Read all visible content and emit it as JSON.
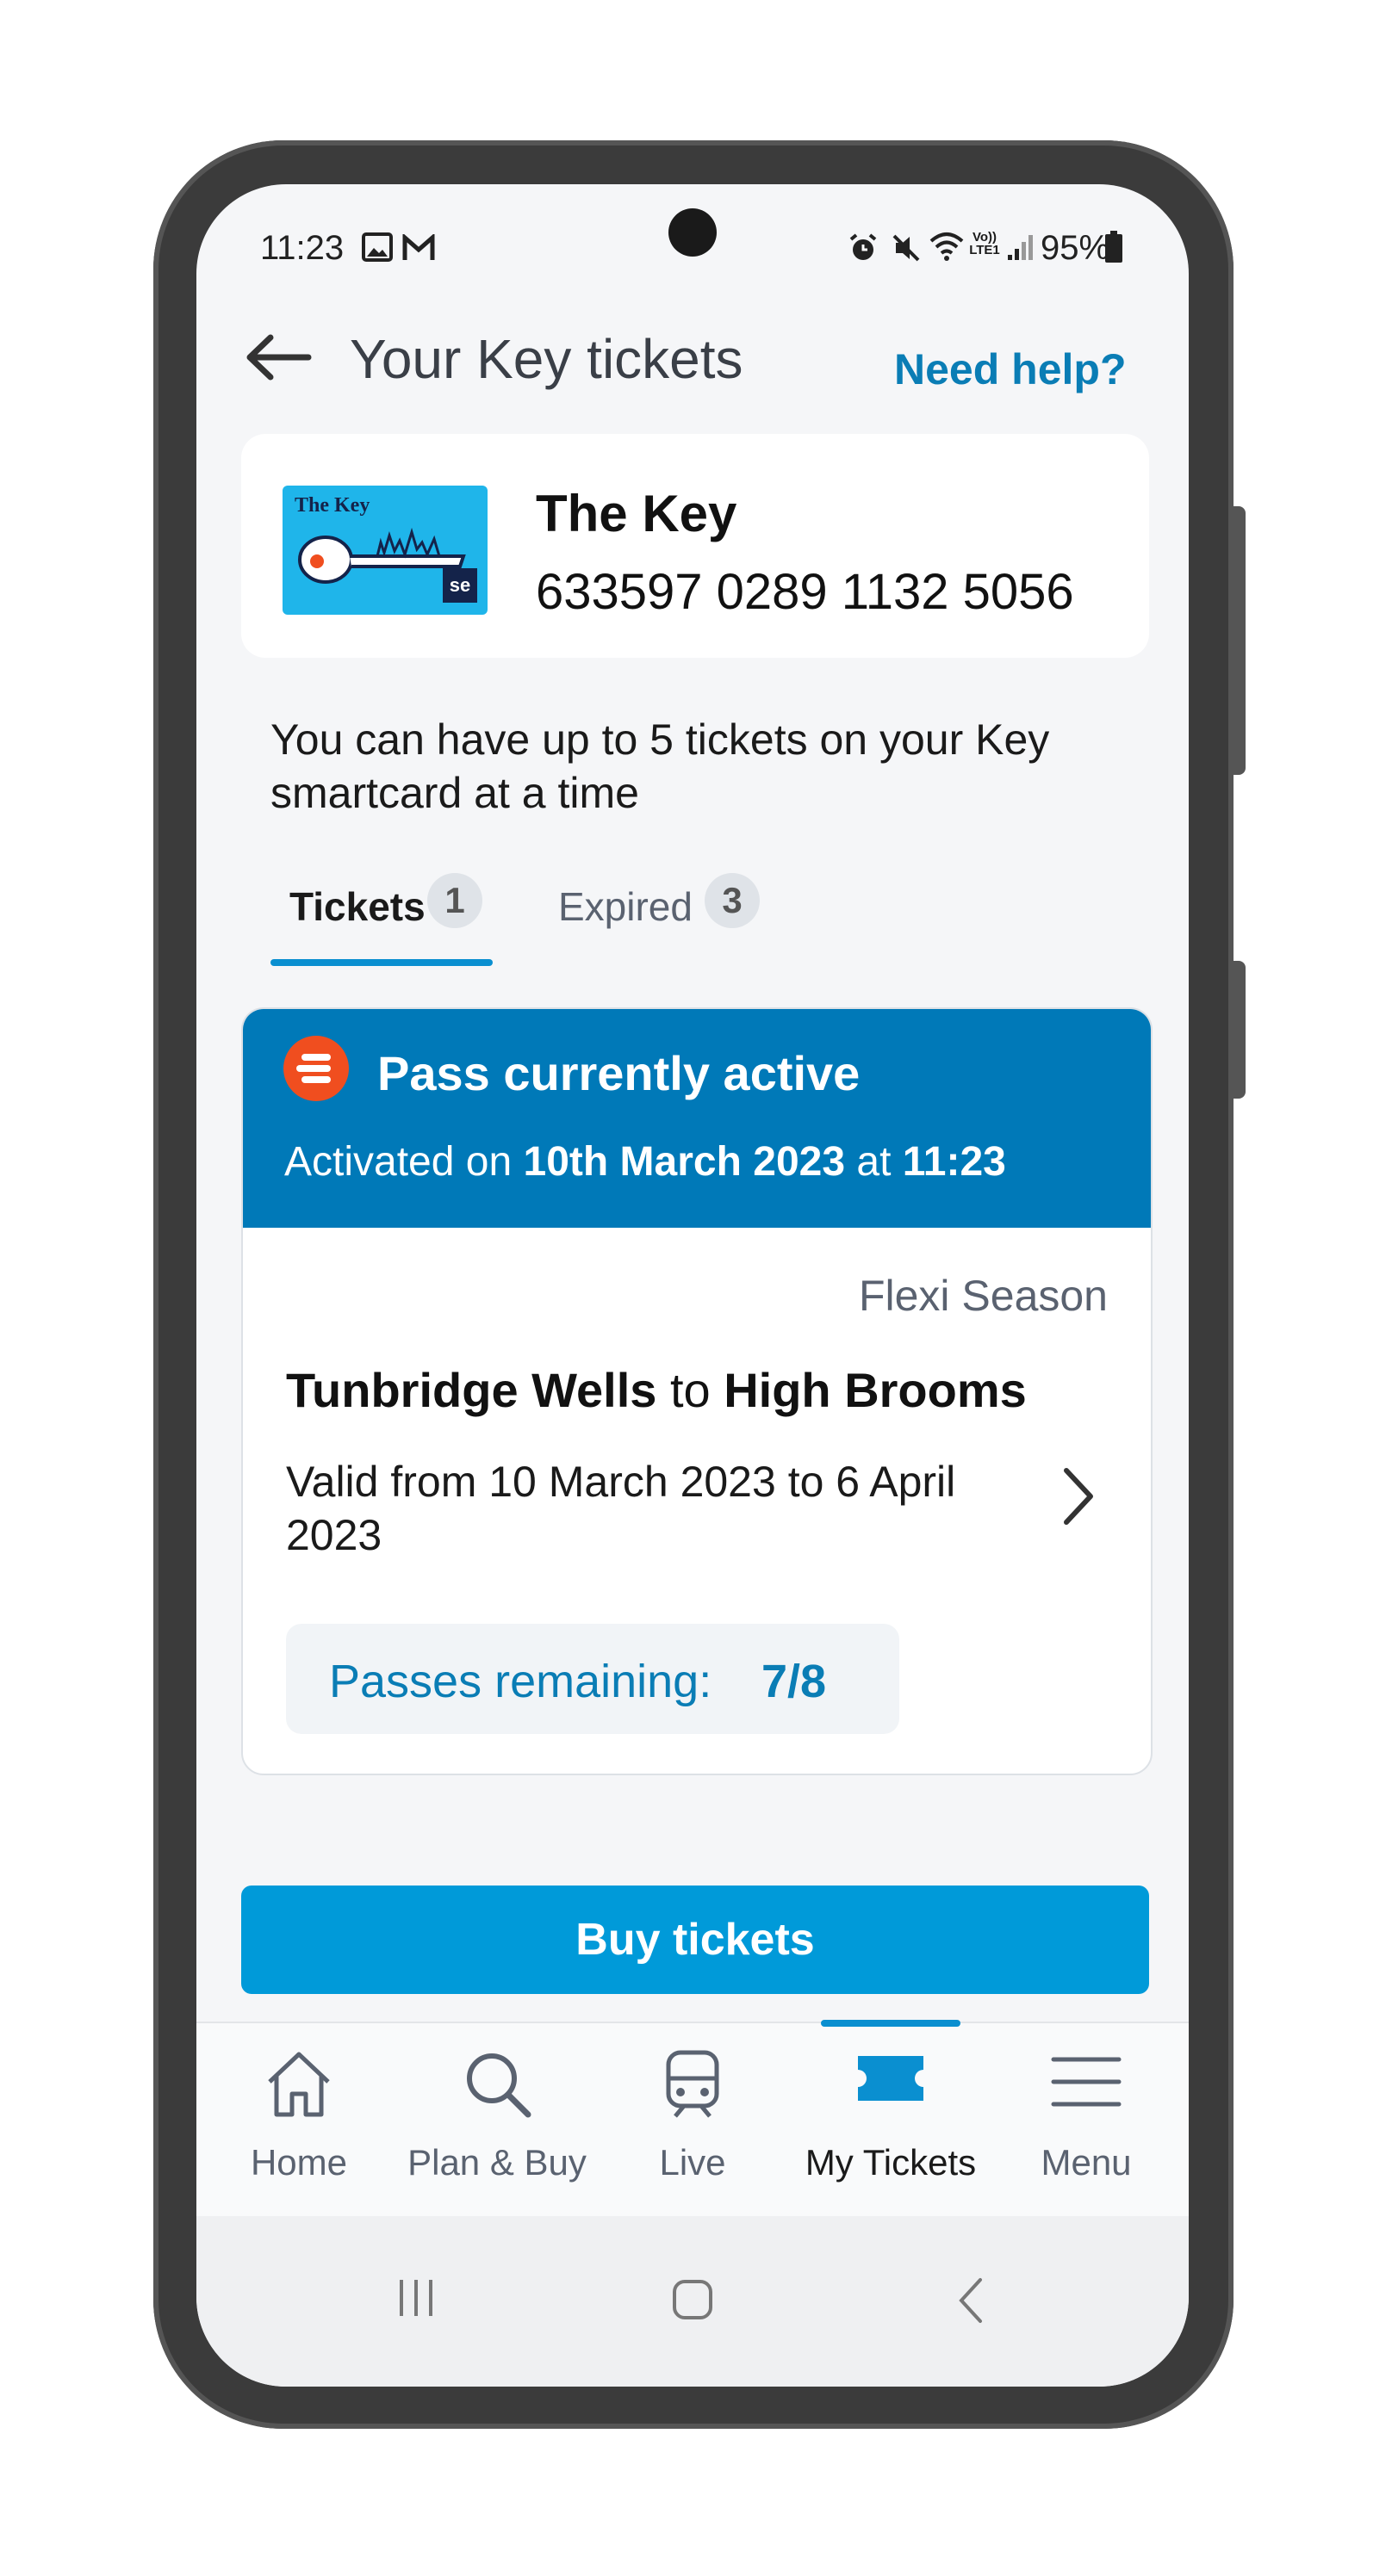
{
  "status_bar": {
    "time": "11:23",
    "battery": "95%",
    "icons": [
      "image-icon",
      "gmail-icon",
      "alarm-icon",
      "mute-icon",
      "wifi-icon",
      "volte-icon",
      "signal-icon",
      "battery-icon"
    ],
    "volte_text": "Vo)) LTE1"
  },
  "header": {
    "title": "Your Key tickets",
    "help_link": "Need help?",
    "back_icon": "arrow-left-icon"
  },
  "key_card": {
    "name": "The Key",
    "number": "633597 0289 1132 5056",
    "image_title": "The Key",
    "image_badge": "se"
  },
  "info_text": "You can have up to 5 tickets on your Key smartcard at a time",
  "tabs": [
    {
      "label": "Tickets",
      "count": "1",
      "active": true
    },
    {
      "label": "Expired",
      "count": "3",
      "active": false
    }
  ],
  "ticket": {
    "status_title": "Pass currently active",
    "activated_prefix": "Activated on ",
    "activated_date": "10th March 2023",
    "activated_at": " at ",
    "activated_time": "11:23",
    "ticket_type": "Flexi Season",
    "origin": "Tunbridge Wells",
    "route_to": " to ",
    "destination": "High Brooms",
    "validity": "Valid from 10 March 2023 to 6 April 2023",
    "passes_label": "Passes remaining:",
    "passes_value": "7/8"
  },
  "buy_button": "Buy tickets",
  "bottom_nav": [
    {
      "label": "Home",
      "icon": "home-icon",
      "active": false
    },
    {
      "label": "Plan & Buy",
      "icon": "search-icon",
      "active": false
    },
    {
      "label": "Live",
      "icon": "train-icon",
      "active": false
    },
    {
      "label": "My Tickets",
      "icon": "ticket-icon",
      "active": true
    },
    {
      "label": "Menu",
      "icon": "menu-icon",
      "active": false
    }
  ],
  "colors": {
    "accent": "#0079b8",
    "button": "#009ad9",
    "badge_orange": "#f04e1f",
    "link": "#0a7db5"
  }
}
